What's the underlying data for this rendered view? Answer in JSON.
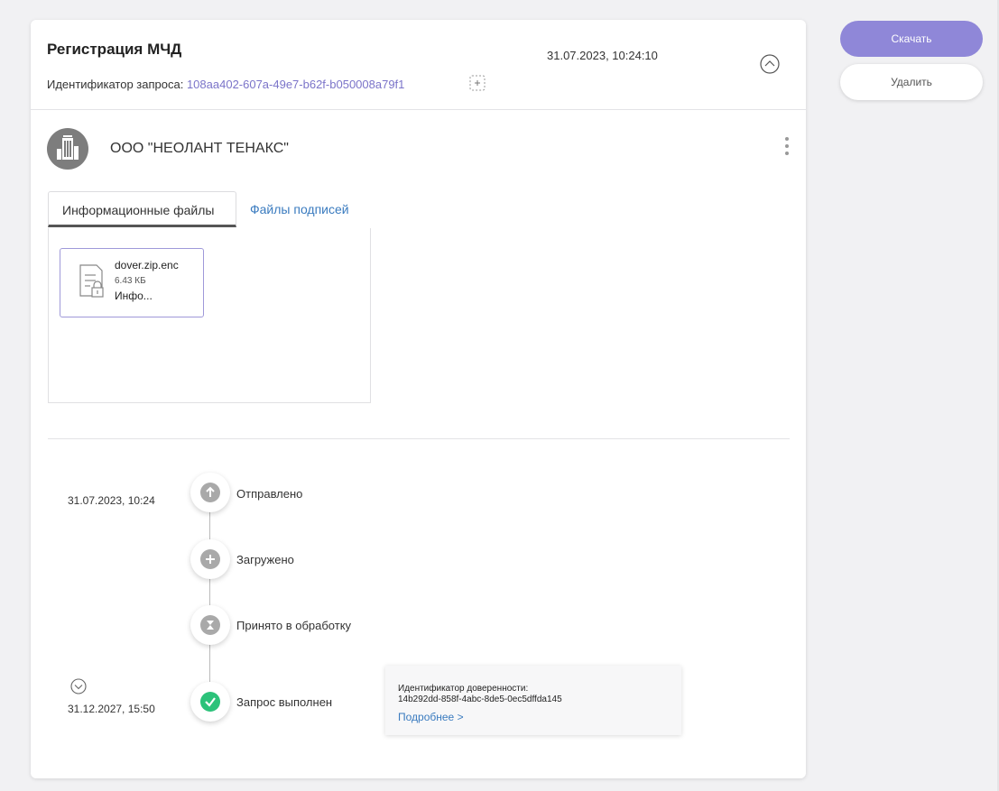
{
  "header": {
    "title": "Регистрация МЧД",
    "date": "31.07.2023, 10:24:10",
    "id_label": "Идентификатор запроса: ",
    "id_value": "108aa402-607a-49e7-b62f-b050008a79f1"
  },
  "organization": {
    "name": "ООО \"НЕОЛАНТ ТЕНАКС\""
  },
  "tabs": [
    {
      "label": "Информационные файлы",
      "active": true
    },
    {
      "label": "Файлы подписей",
      "active": false
    }
  ],
  "file": {
    "name": "dover.zip.enc",
    "size": "6.43 КБ",
    "type": "Инфо..."
  },
  "timeline": {
    "steps": [
      {
        "label": "Отправлено",
        "icon": "arrow-up-icon",
        "date": "31.07.2023, 10:24"
      },
      {
        "label": "Загружено",
        "icon": "plus-icon",
        "date": ""
      },
      {
        "label": "Принято в обработку",
        "icon": "hourglass-icon",
        "date": ""
      },
      {
        "label": "Запрос выполнен",
        "icon": "check-icon",
        "date": "31.12.2027, 15:50"
      }
    ]
  },
  "info_box": {
    "title": "Идентификатор доверенности:",
    "value": "14b292dd-858f-4abc-8de5-0ec5dffda145",
    "link": "Подробнее >"
  },
  "actions": {
    "download": "Скачать",
    "delete": "Удалить"
  },
  "colors": {
    "accent": "#8f87d8",
    "link": "#3a7bbf",
    "success": "#2cc27a",
    "id_value": "#7b74c9"
  }
}
